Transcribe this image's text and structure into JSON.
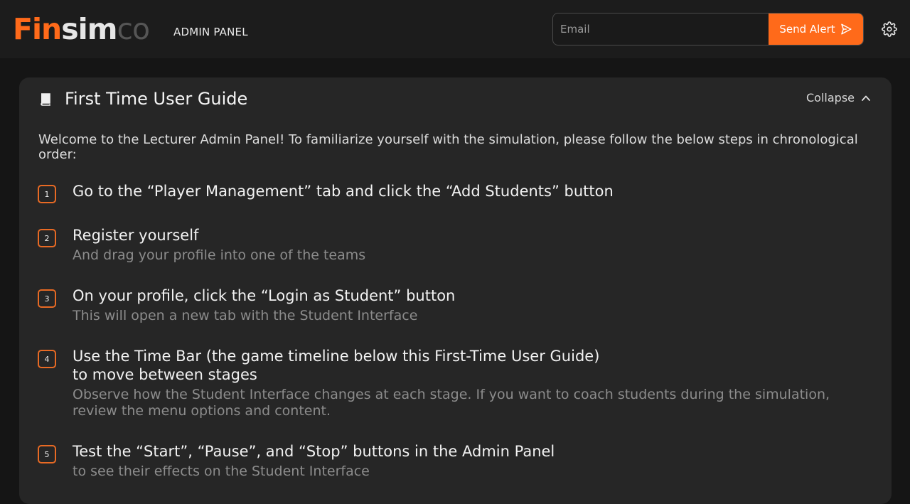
{
  "header": {
    "logo_parts": [
      "Fin",
      "sim",
      "co"
    ],
    "admin_label": "ADMIN PANEL",
    "email_placeholder": "Email",
    "send_label": "Send Alert",
    "icons": {
      "send": "send-icon",
      "settings": "gear-icon"
    },
    "colors": {
      "accent": "#ff6a1a",
      "background": "#1c1c1c"
    }
  },
  "guide": {
    "title": "First Time User Guide",
    "collapse_label": "Collapse",
    "intro": "Welcome to the Lecturer Admin Panel! To familiarize yourself with the simulation, please follow the below steps in chronological order:",
    "steps": [
      {
        "number": "1",
        "title": "Go to the “Player Management” tab and click the “Add Students” button",
        "subtitle": ""
      },
      {
        "number": "2",
        "title": "Register yourself",
        "subtitle": "And drag your profile into one of the teams"
      },
      {
        "number": "3",
        "title": "On your profile, click the “Login as Student” button",
        "subtitle": "This will open a new tab with the Student Interface"
      },
      {
        "number": "4",
        "title": "Use the Time Bar (the game timeline below this First-Time User Guide) to move between stages",
        "subtitle": "Observe how the Student Interface changes at each stage. If you want to coach students during the simulation, review the menu options and content."
      },
      {
        "number": "5",
        "title": "Test the “Start”, “Pause”, and “Stop” buttons in the Admin Panel",
        "subtitle": "to see their effects on the Student Interface"
      }
    ]
  }
}
